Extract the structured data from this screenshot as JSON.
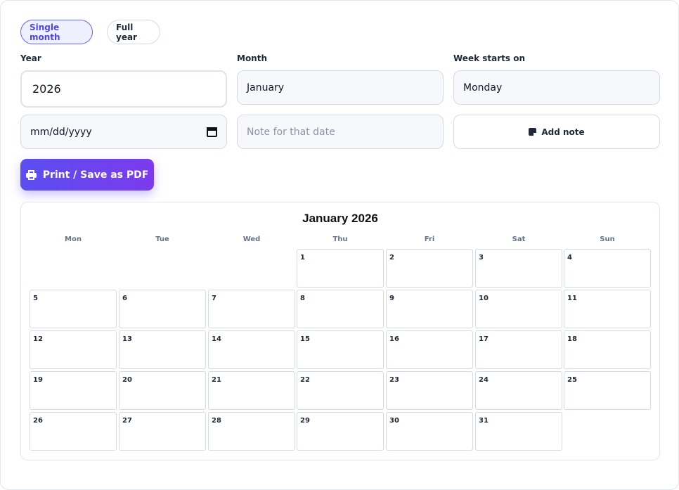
{
  "modes": {
    "single": "Single month",
    "full": "Full year"
  },
  "form": {
    "year_label": "Year",
    "year_value": "2026",
    "month_label": "Month",
    "month_value": "January",
    "week_label": "Week starts on",
    "week_value": "Monday",
    "date_placeholder": "mm/dd/yyyy",
    "note_placeholder": "Note for that date",
    "add_note_label": "Add note"
  },
  "actions": {
    "print_label": "Print / Save as PDF"
  },
  "calendar": {
    "title": "January 2026",
    "weekdays": [
      "Mon",
      "Tue",
      "Wed",
      "Thu",
      "Fri",
      "Sat",
      "Sun"
    ],
    "first_weekday_index": 3,
    "days_in_month": 31
  },
  "colors": {
    "accent": "#5b4ef0",
    "accent_end": "#7c3aed",
    "active_toggle_bg": "#eef0fd"
  }
}
